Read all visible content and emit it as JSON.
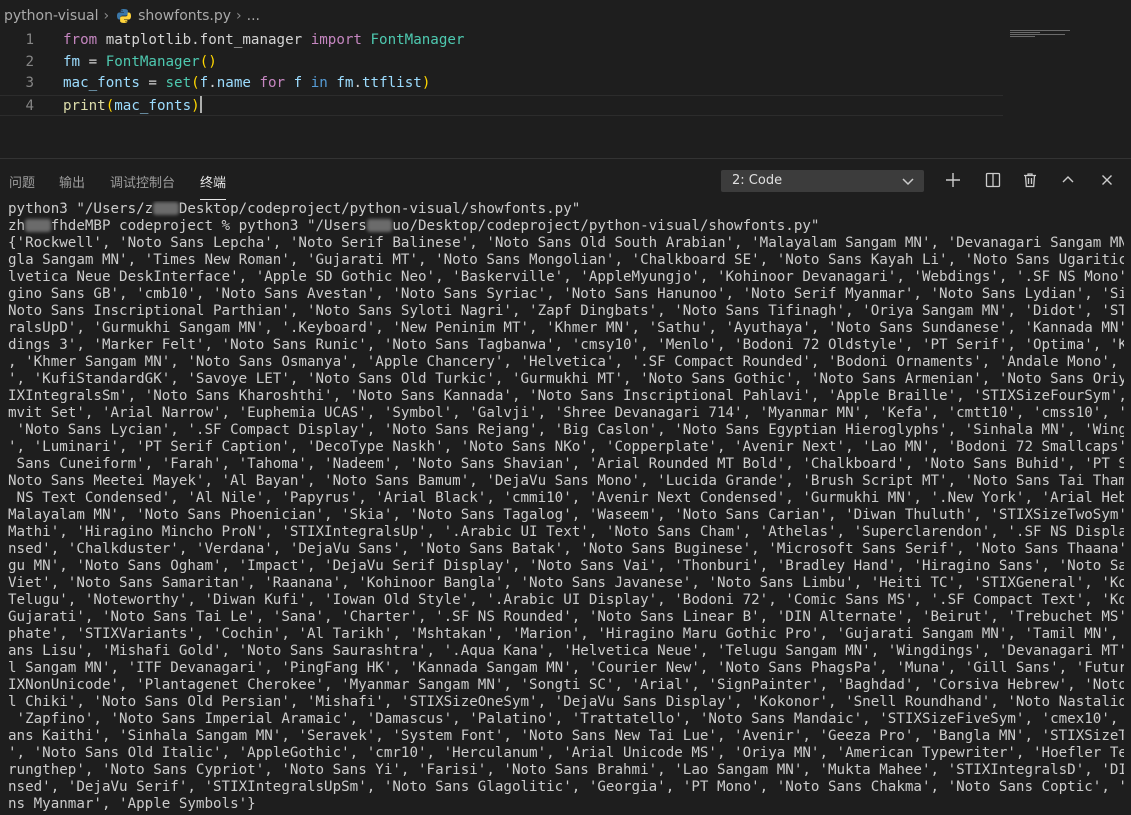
{
  "breadcrumb": {
    "folder": "python-visual",
    "file": "showfonts.py",
    "symbol": "..."
  },
  "editor": {
    "lines": [
      {
        "num": "1",
        "segments": [
          {
            "t": "from",
            "c": "kw"
          },
          {
            "t": " matplotlib.font_manager ",
            "c": "op"
          },
          {
            "t": "import",
            "c": "kw"
          },
          {
            "t": " FontManager",
            "c": "cls"
          }
        ]
      },
      {
        "num": "2",
        "segments": [
          {
            "t": "fm",
            "c": "var"
          },
          {
            "t": " = ",
            "c": "op"
          },
          {
            "t": "FontManager",
            "c": "cls"
          },
          {
            "t": "()",
            "c": "br"
          }
        ]
      },
      {
        "num": "3",
        "segments": [
          {
            "t": "mac_fonts",
            "c": "var"
          },
          {
            "t": " = ",
            "c": "op"
          },
          {
            "t": "set",
            "c": "cls"
          },
          {
            "t": "(",
            "c": "br"
          },
          {
            "t": "f",
            "c": "var"
          },
          {
            "t": ".",
            "c": "op"
          },
          {
            "t": "name",
            "c": "var"
          },
          {
            "t": " for ",
            "c": "kw"
          },
          {
            "t": "f",
            "c": "var"
          },
          {
            "t": " in ",
            "c": "kw2"
          },
          {
            "t": "fm",
            "c": "var"
          },
          {
            "t": ".",
            "c": "op"
          },
          {
            "t": "ttflist",
            "c": "var"
          },
          {
            "t": ")",
            "c": "br"
          }
        ]
      },
      {
        "num": "4",
        "segments": [
          {
            "t": "print",
            "c": "fn"
          },
          {
            "t": "(",
            "c": "br"
          },
          {
            "t": "mac_fonts",
            "c": "var"
          },
          {
            "t": ")",
            "c": "br"
          }
        ]
      }
    ]
  },
  "panel": {
    "tabs": [
      "问题",
      "输出",
      "调试控制台",
      "终端"
    ],
    "active_tab": "终端",
    "terminal_select": "2: Code"
  },
  "terminal": {
    "lines": [
      "python3 \"/Users/z    Desktop/codeproject/python-visual/showfonts.py\"",
      "zh    fhdeMBP codeproject % python3 \"/Users    uo/Desktop/codeproject/python-visual/showfonts.py\"",
      "{'Rockwell', 'Noto Sans Lepcha', 'Noto Serif Balinese', 'Noto Sans Old South Arabian', 'Malayalam Sangam MN', 'Devanagari Sangam MN', 'Ban",
      "gla Sangam MN', 'Times New Roman', 'Gujarati MT', 'Noto Sans Mongolian', 'Chalkboard SE', 'Noto Sans Kayah Li', 'Noto Sans Ugaritic', '.He",
      "lvetica Neue DeskInterface', 'Apple SD Gothic Neo', 'Baskerville', 'AppleMyungjo', 'Kohinoor Devanagari', 'Webdings', '.SF NS Mono', 'Hira",
      "gino Sans GB', 'cmb10', 'Noto Sans Avestan', 'Noto Sans Syriac', 'Noto Sans Hanunoo', 'Noto Serif Myanmar', 'Noto Sans Lydian', 'Silom', '",
      "Noto Sans Inscriptional Parthian', 'Noto Sans Syloti Nagri', 'Zapf Dingbats', 'Noto Sans Tifinagh', 'Oriya Sangam MN', 'Didot', 'STIXInteg",
      "ralsUpD', 'Gurmukhi Sangam MN', '.Keyboard', 'New Peninim MT', 'Khmer MN', 'Sathu', 'Ayuthaya', 'Noto Sans Sundanese', 'Kannada MN', 'Wing",
      "dings 3', 'Marker Felt', 'Noto Sans Runic', 'Noto Sans Tagbanwa', 'cmsy10', 'Menlo', 'Bodoni 72 Oldstyle', 'PT Serif', 'Optima', 'Kailasa'",
      ", 'Khmer Sangam MN', 'Noto Sans Osmanya', 'Apple Chancery', 'Helvetica', '.SF Compact Rounded', 'Bodoni Ornaments', 'Andale Mono', 'SimHei",
      "', 'KufiStandardGK', 'Savoye LET', 'Noto Sans Old Turkic', 'Gurmukhi MT', 'Noto Sans Gothic', 'Noto Sans Armenian', 'Noto Sans Oriya', 'ST",
      "IXIntegralsSm', 'Noto Sans Kharoshthi', 'Noto Sans Kannada', 'Noto Sans Inscriptional Pahlavi', 'Apple Braille', 'STIXSizeFourSym', 'Sukhu",
      "mvit Set', 'Arial Narrow', 'Euphemia UCAS', 'Symbol', 'Galvji', 'Shree Devanagari 714', 'Myanmar MN', 'Kefa', 'cmtt10', 'cmss10', 'Times',",
      " 'Noto Sans Lycian', '.SF Compact Display', 'Noto Sans Rejang', 'Big Caslon', 'Noto Sans Egyptian Hieroglyphs', 'Sinhala MN', 'Wingdings 2",
      "', 'Luminari', 'PT Serif Caption', 'DecoType Naskh', 'Noto Sans NKo', 'Copperplate', 'Avenir Next', 'Lao MN', 'Bodoni 72 Smallcaps', 'Noto",
      " Sans Cuneiform', 'Farah', 'Tahoma', 'Nadeem', 'Noto Sans Shavian', 'Arial Rounded MT Bold', 'Chalkboard', 'Noto Sans Buhid', 'PT Sans', '",
      "Noto Sans Meetei Mayek', 'Al Bayan', 'Noto Sans Bamum', 'DejaVu Sans Mono', 'Lucida Grande', 'Brush Script MT', 'Noto Sans Tai Tham', '.SF",
      " NS Text Condensed', 'Al Nile', 'Papyrus', 'Arial Black', 'cmmi10', 'Avenir Next Condensed', 'Gurmukhi MN', '.New York', 'Arial Hebrew', '",
      "Malayalam MN', 'Noto Sans Phoenician', 'Skia', 'Noto Sans Tagalog', 'Waseem', 'Noto Sans Carian', 'Diwan Thuluth', 'STIXSizeTwoSym', 'Inai",
      "Mathi', 'Hiragino Mincho ProN', 'STIXIntegralsUp', '.Arabic UI Text', 'Noto Sans Cham', 'Athelas', 'Superclarendon', '.SF NS Display Conde",
      "nsed', 'Chalkduster', 'Verdana', 'DejaVu Sans', 'Noto Sans Batak', 'Noto Sans Buginese', 'Microsoft Sans Serif', 'Noto Sans Thaana', 'Telu",
      "gu MN', 'Noto Sans Ogham', 'Impact', 'DejaVu Serif Display', 'Noto Sans Vai', 'Thonburi', 'Bradley Hand', 'Hiragino Sans', 'Noto Sans Tai",
      "Viet', 'Noto Sans Samaritan', 'Raanana', 'Kohinoor Bangla', 'Noto Sans Javanese', 'Noto Sans Limbu', 'Heiti TC', 'STIXGeneral', 'Kohinoor",
      "Telugu', 'Noteworthy', 'Diwan Kufi', 'Iowan Old Style', '.Arabic UI Display', 'Bodoni 72', 'Comic Sans MS', '.SF Compact Text', 'Kohinoor",
      "Gujarati', 'Noto Sans Tai Le', 'Sana', 'Charter', '.SF NS Rounded', 'Noto Sans Linear B', 'DIN Alternate', 'Beirut', 'Trebuchet MS', 'Phos",
      "phate', 'STIXVariants', 'Cochin', 'Al Tarikh', 'Mshtakan', 'Marion', 'Hiragino Maru Gothic Pro', 'Gujarati Sangam MN', 'Tamil MN', 'Noto S",
      "ans Lisu', 'Mishafi Gold', 'Noto Sans Saurashtra', '.Aqua Kana', 'Helvetica Neue', 'Telugu Sangam MN', 'Wingdings', 'Devanagari MT', 'Tami",
      "l Sangam MN', 'ITF Devanagari', 'PingFang HK', 'Kannada Sangam MN', 'Courier New', 'Noto Sans PhagsPa', 'Muna', 'Gill Sans', 'Futura', 'ST",
      "IXNonUnicode', 'Plantagenet Cherokee', 'Myanmar Sangam MN', 'Songti SC', 'Arial', 'SignPainter', 'Baghdad', 'Corsiva Hebrew', 'Noto Sans O",
      "l Chiki', 'Noto Sans Old Persian', 'Mishafi', 'STIXSizeOneSym', 'DejaVu Sans Display', 'Kokonor', 'Snell Roundhand', 'Noto Nastaliq Urdu',",
      " 'Zapfino', 'Noto Sans Imperial Aramaic', 'Damascus', 'Palatino', 'Trattatello', 'Noto Sans Mandaic', 'STIXSizeFiveSym', 'cmex10', 'Noto S",
      "ans Kaithi', 'Sinhala Sangam MN', 'Seravek', 'System Font', 'Noto Sans New Tai Lue', 'Avenir', 'Geeza Pro', 'Bangla MN', 'STIXSizeThreeSym",
      "', 'Noto Sans Old Italic', 'AppleGothic', 'cmr10', 'Herculanum', 'Arial Unicode MS', 'Oriya MN', 'American Typewriter', 'Hoefler Text', 'K",
      "rungthep', 'Noto Sans Cypriot', 'Noto Sans Yi', 'Farisi', 'Noto Sans Brahmi', 'Lao Sangam MN', 'Mukta Mahee', 'STIXIntegralsD', 'DIN Conde",
      "nsed', 'DejaVu Serif', 'STIXIntegralsUpSm', 'Noto Sans Glagolitic', 'Georgia', 'PT Mono', 'Noto Sans Chakma', 'Noto Sans Coptic', 'Noto Sa",
      "ns Myanmar', 'Apple Symbols'}"
    ]
  },
  "icons": {
    "file": "python-icon",
    "toolbar": [
      "plus-icon",
      "split-icon",
      "trash-icon",
      "chevron-up-icon",
      "close-icon"
    ]
  }
}
